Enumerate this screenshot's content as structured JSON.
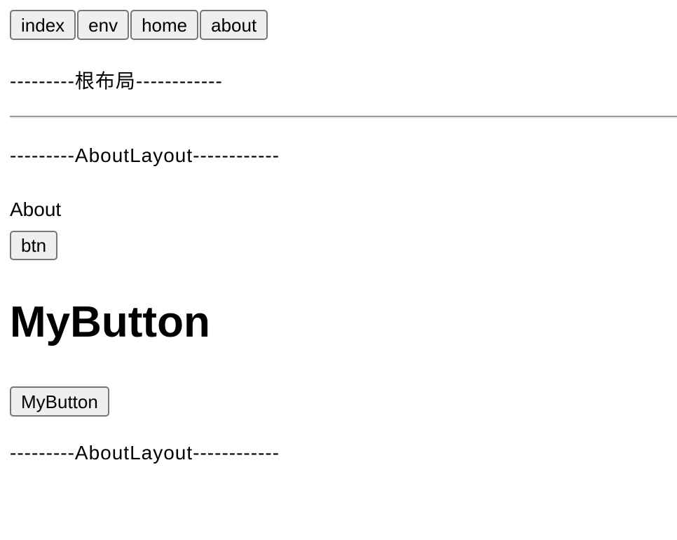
{
  "nav": {
    "items": [
      "index",
      "env",
      "home",
      "about"
    ]
  },
  "root_layout_text": "---------根布局------------",
  "about_layout_text_top": "---------AboutLayout------------",
  "about_text": "About",
  "btn_label": "btn",
  "heading": "MyButton",
  "my_button_label": "MyButton",
  "about_layout_text_bottom": "---------AboutLayout------------"
}
